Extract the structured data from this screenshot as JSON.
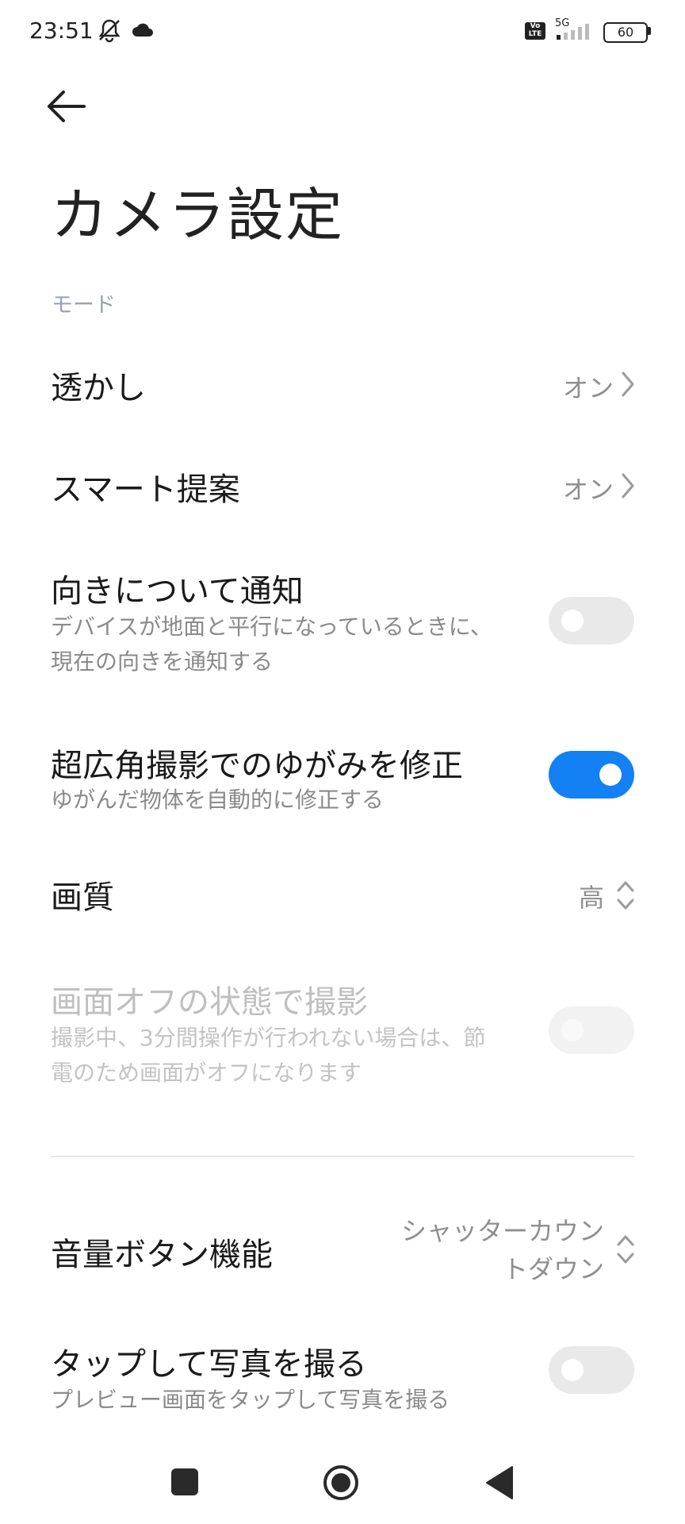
{
  "status_bar": {
    "time": "23:51",
    "volte_label": "Vo LTE",
    "network_label": "5G",
    "battery_level": "60"
  },
  "header": {
    "title": "カメラ設定"
  },
  "section_mode": "モード",
  "settings": {
    "watermark": {
      "label": "透かし",
      "value": "オン"
    },
    "smart_suggestions": {
      "label": "スマート提案",
      "value": "オン"
    },
    "orientation_notice": {
      "label": "向きについて通知",
      "sub1": "デバイスが地面と平行になっているときに、",
      "sub2": "現在の向きを通知する",
      "enabled": false
    },
    "ultrawide_correction": {
      "label": "超広角撮影でのゆがみを修正",
      "sub": "ゆがんだ物体を自動的に修正する",
      "enabled": true
    },
    "quality": {
      "label": "画質",
      "value": "高"
    },
    "screen_off_capture": {
      "label": "画面オフの状態で撮影",
      "sub1": "撮影中、3分間操作が行われない場合は、節",
      "sub2": "電のため画面がオフになります",
      "enabled": false,
      "disabled": true
    },
    "volume_button": {
      "label": "音量ボタン機能",
      "value_line1": "シャッターカウン",
      "value_line2": "トダウン"
    },
    "tap_to_capture": {
      "label": "タップして写真を撮る",
      "sub": "プレビュー画面をタップして写真を撮る",
      "enabled": false
    }
  },
  "colors": {
    "accent": "#1380f4",
    "text_primary": "#1a1a1a",
    "text_secondary": "#8a8a8a",
    "section": "#9aa0ab"
  }
}
